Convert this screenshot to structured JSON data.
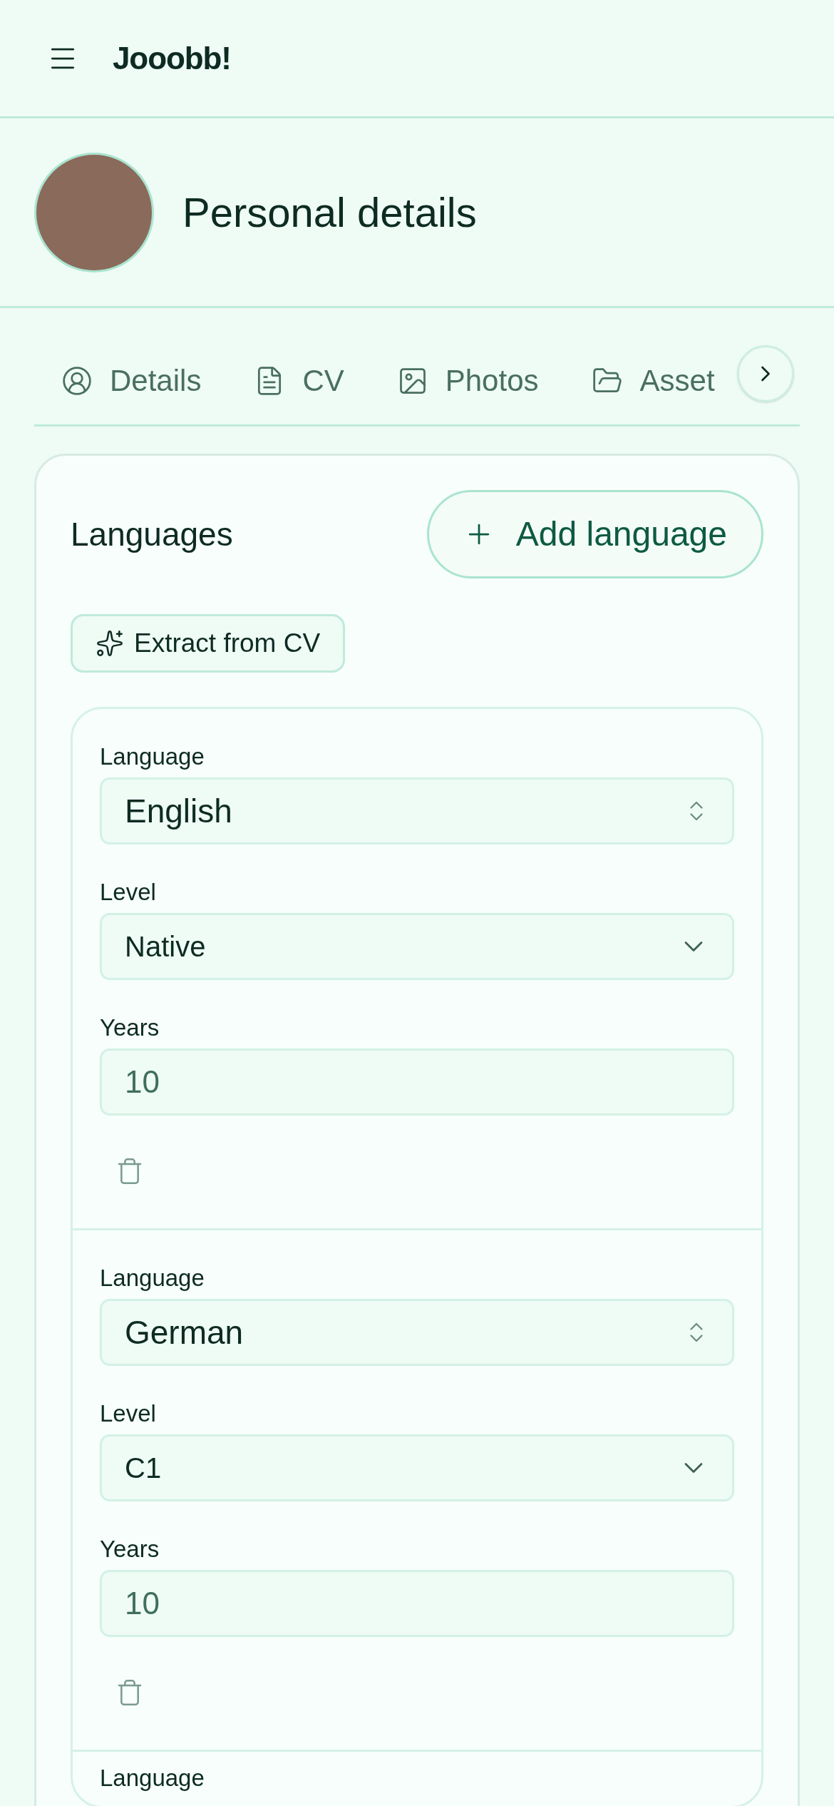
{
  "header": {
    "title": "Jooobb!"
  },
  "hero": {
    "title": "Personal details"
  },
  "tabs": [
    {
      "label": "Details",
      "kind": "user"
    },
    {
      "label": "CV",
      "kind": "file"
    },
    {
      "label": "Photos",
      "kind": "image"
    },
    {
      "label": "Asset",
      "kind": "folder"
    }
  ],
  "languages": {
    "title": "Languages",
    "add_button": "Add language",
    "extract_button": "Extract from CV",
    "entries": [
      {
        "language_label": "Language",
        "language": "English",
        "level_label": "Level",
        "level": "Native",
        "years_label": "Years",
        "years": "10"
      },
      {
        "language_label": "Language",
        "language": "German",
        "level_label": "Level",
        "level": "C1",
        "years_label": "Years",
        "years": "10"
      },
      {
        "language_label": "Language"
      }
    ]
  }
}
